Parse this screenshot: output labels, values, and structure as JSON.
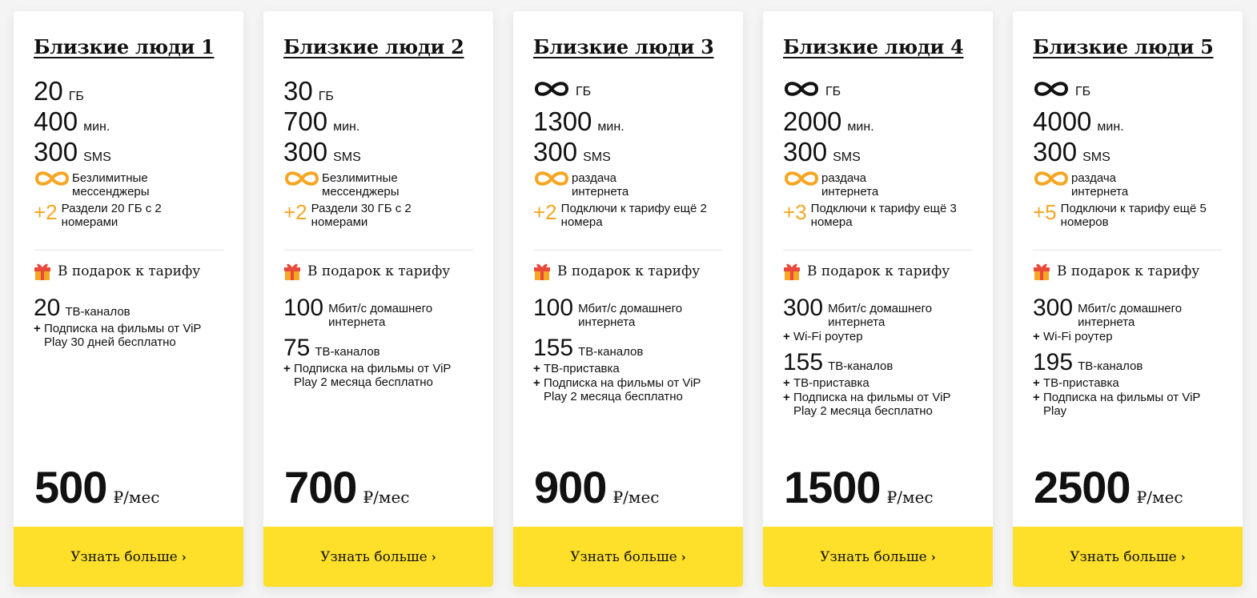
{
  "accent_color": "#fee02b",
  "icon_color": "#f5a623",
  "gift_heading": "В подарок к тарифу",
  "button_label": "Узнать больше",
  "price_unit": "₽/мес",
  "cards": [
    {
      "title": "Близкие люди 1",
      "data": {
        "value": "20",
        "unlimited": false,
        "unit": "ГБ"
      },
      "minutes": {
        "value": "400",
        "unit": "мин."
      },
      "sms": {
        "value": "300",
        "unit": "SMS"
      },
      "feature_infinity": "Безлимитные мессенджеры",
      "feature_plus": {
        "count": "+2",
        "text": "Раздели 20 ГБ с 2 номерами"
      },
      "gifts": [
        {
          "num": "20",
          "text": "ТВ-каналов",
          "plus": [
            "Подписка на фильмы от ViP Play 30 дней бесплатно"
          ]
        }
      ],
      "price": "500"
    },
    {
      "title": "Близкие люди 2",
      "data": {
        "value": "30",
        "unlimited": false,
        "unit": "ГБ"
      },
      "minutes": {
        "value": "700",
        "unit": "мин."
      },
      "sms": {
        "value": "300",
        "unit": "SMS"
      },
      "feature_infinity": "Безлимитные мессенджеры",
      "feature_plus": {
        "count": "+2",
        "text": "Раздели 30 ГБ с 2 номерами"
      },
      "gifts": [
        {
          "num": "100",
          "text": "Мбит/с домашнего интернета",
          "plus": []
        },
        {
          "num": "75",
          "text": "ТВ-каналов",
          "plus": [
            "Подписка на фильмы от ViP Play 2 месяца бесплатно"
          ]
        }
      ],
      "price": "700"
    },
    {
      "title": "Близкие люди 3",
      "data": {
        "value": "",
        "unlimited": true,
        "unit": "ГБ"
      },
      "minutes": {
        "value": "1300",
        "unit": "мин."
      },
      "sms": {
        "value": "300",
        "unit": "SMS"
      },
      "feature_infinity": "раздача интернета",
      "feature_plus": {
        "count": "+2",
        "text": "Подключи к тарифу ещё 2 номера"
      },
      "gifts": [
        {
          "num": "100",
          "text": "Мбит/с домашнего интернета",
          "plus": []
        },
        {
          "num": "155",
          "text": "ТВ-каналов",
          "plus": [
            "ТВ-приставка",
            "Подписка на фильмы от ViP Play 2 месяца бесплатно"
          ]
        }
      ],
      "price": "900"
    },
    {
      "title": "Близкие люди 4",
      "data": {
        "value": "",
        "unlimited": true,
        "unit": "ГБ"
      },
      "minutes": {
        "value": "2000",
        "unit": "мин."
      },
      "sms": {
        "value": "300",
        "unit": "SMS"
      },
      "feature_infinity": "раздача интернета",
      "feature_plus": {
        "count": "+3",
        "text": "Подключи к тарифу ещё 3 номера"
      },
      "gifts": [
        {
          "num": "300",
          "text": "Мбит/с домашнего интернета",
          "plus": [
            "Wi-Fi роутер"
          ]
        },
        {
          "num": "155",
          "text": "ТВ-каналов",
          "plus": [
            "ТВ-приставка",
            "Подписка на фильмы от ViP Play 2 месяца бесплатно"
          ]
        }
      ],
      "price": "1500"
    },
    {
      "title": "Близкие люди 5",
      "data": {
        "value": "",
        "unlimited": true,
        "unit": "ГБ"
      },
      "minutes": {
        "value": "4000",
        "unit": "мин."
      },
      "sms": {
        "value": "300",
        "unit": "SMS"
      },
      "feature_infinity": "раздача интернета",
      "feature_plus": {
        "count": "+5",
        "text": "Подключи к тарифу ещё 5 номеров"
      },
      "gifts": [
        {
          "num": "300",
          "text": "Мбит/с домашнего интернета",
          "plus": [
            "Wi-Fi роутер"
          ]
        },
        {
          "num": "195",
          "text": "ТВ-каналов",
          "plus": [
            "ТВ-приставка",
            "Подписка на фильмы от ViP Play"
          ]
        }
      ],
      "price": "2500"
    }
  ]
}
